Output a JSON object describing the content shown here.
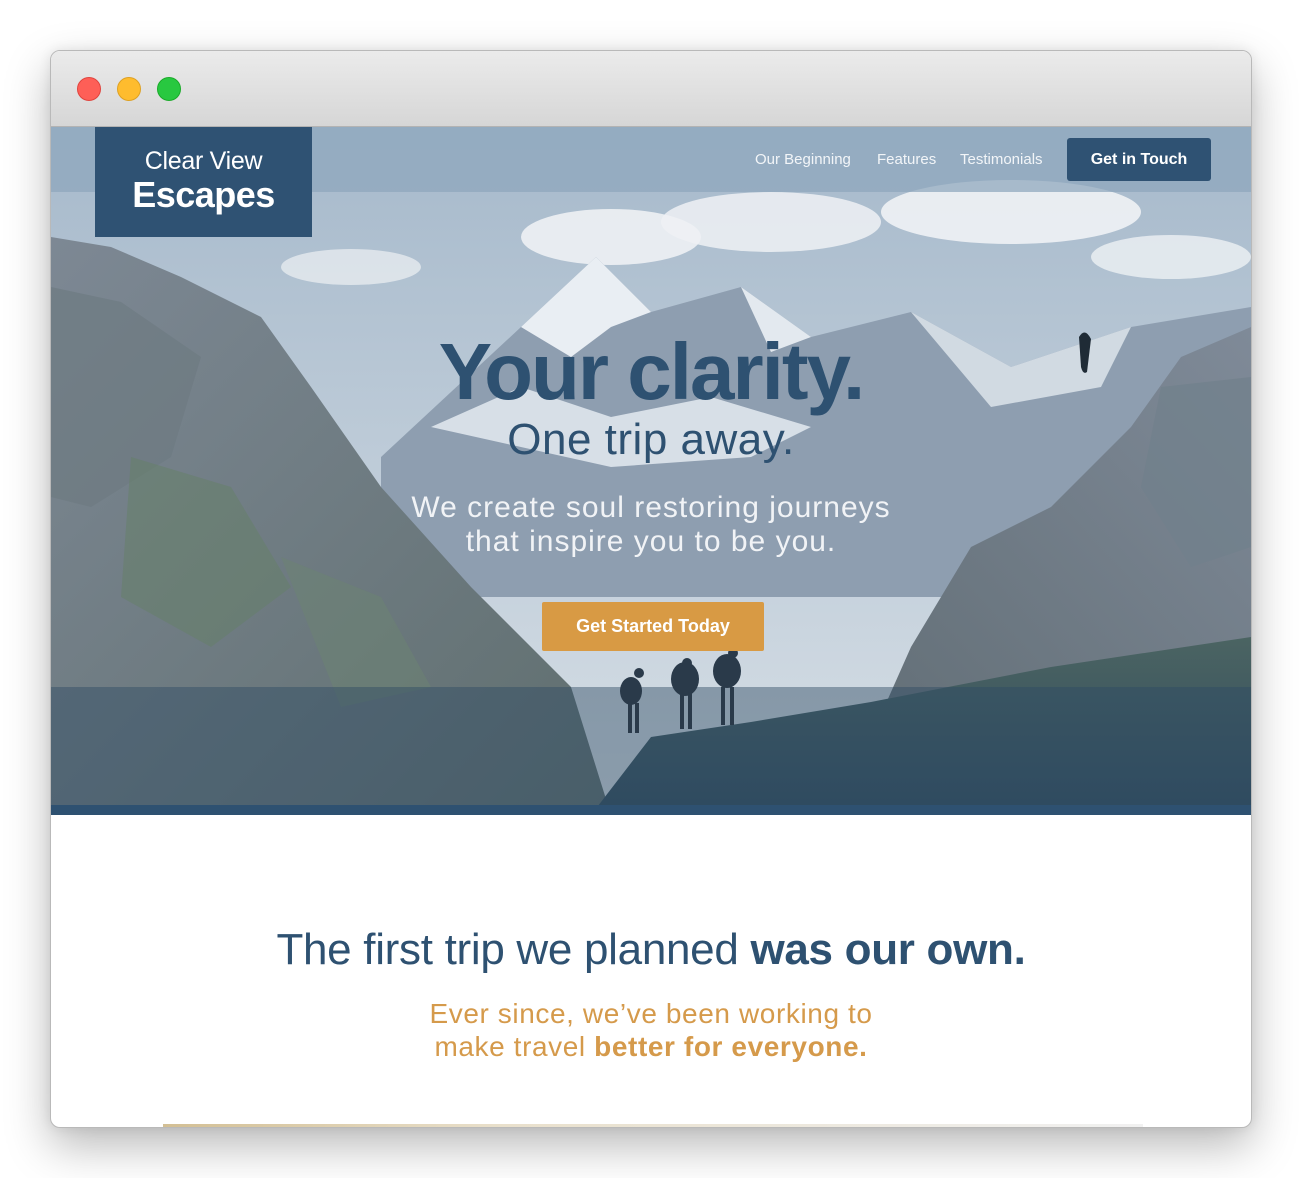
{
  "window": {
    "controls": [
      "close",
      "minimize",
      "zoom"
    ]
  },
  "brand": {
    "line1": "Clear View",
    "line2": "Escapes",
    "primary_color": "#2f5273",
    "accent_color": "#d89a44"
  },
  "nav": {
    "links": [
      "Our Beginning",
      "Features",
      "Testimonials"
    ],
    "button": "Get in Touch"
  },
  "hero": {
    "headline": "Your clarity.",
    "subheadline": "One trip away.",
    "tagline_line1": "We create soul restoring journeys",
    "tagline_line2": "that inspire you to be you.",
    "cta": "Get Started Today"
  },
  "intro": {
    "title_light": "The first trip we planned ",
    "title_bold": "was our own.",
    "sub_line1": "Ever since, we’ve been working to",
    "sub_line2_light": "make travel ",
    "sub_line2_bold": "better for everyone."
  }
}
